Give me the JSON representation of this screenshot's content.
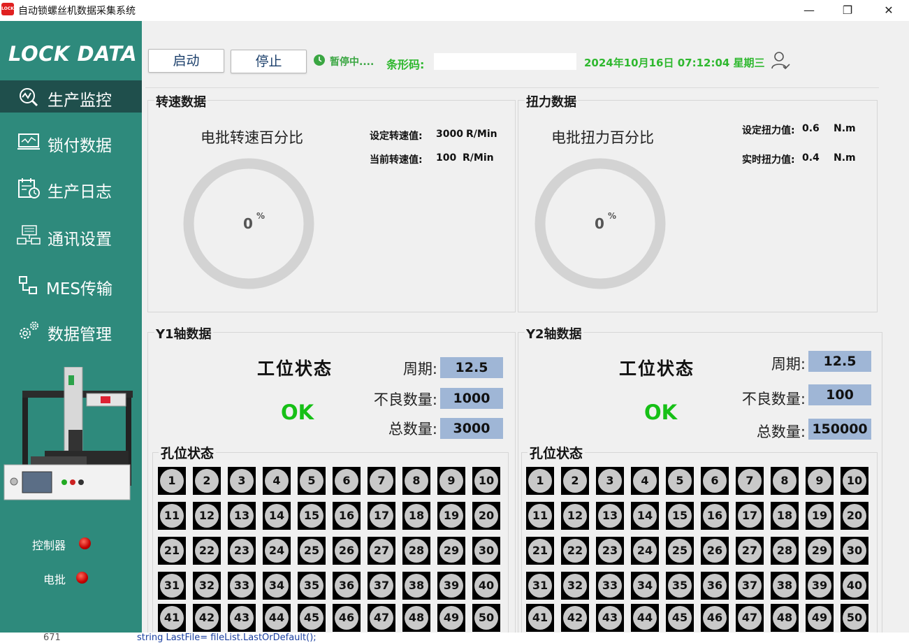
{
  "window": {
    "title": "自动锁螺丝机数据采集系统",
    "icon_text": "LOCK",
    "icon_color": "#e02020"
  },
  "sidebar": {
    "logo": "LOCK DATA",
    "bg_color": "#2e8a7c",
    "active_color": "#1f4f4c",
    "items": [
      {
        "label": "生产监控",
        "icon": "analytics-icon"
      },
      {
        "label": "锁付数据",
        "icon": "monitor-chart-icon"
      },
      {
        "label": "生产日志",
        "icon": "calendar-clock-icon"
      },
      {
        "label": "通讯设置",
        "icon": "network-icon"
      },
      {
        "label": "MES传输",
        "icon": "flow-icon"
      },
      {
        "label": "数据管理",
        "icon": "gears-icon"
      }
    ],
    "indicators": [
      {
        "label": "控制器",
        "status": "red"
      },
      {
        "label": "电批",
        "status": "red"
      }
    ]
  },
  "toolbar": {
    "start_label": "启动",
    "stop_label": "停止",
    "status_text": "暂停中....",
    "barcode_label": "条形码:",
    "barcode_value": "",
    "datetime": "2024年10月16日 07:12:04 星期三",
    "status_color": "#3aa642"
  },
  "speed_panel": {
    "title": "转速数据",
    "gauge_title": "电批转速百分比",
    "gauge_value": "0",
    "gauge_unit": "%",
    "gauge_percent": 0,
    "set_label": "设定转速值:",
    "set_value": "3000",
    "set_unit": "R/Min",
    "cur_label": "当前转速值:",
    "cur_value": "100",
    "cur_unit": "R/Min"
  },
  "torque_panel": {
    "title": "扭力数据",
    "gauge_title": "电批扭力百分比",
    "gauge_value": "0",
    "gauge_unit": "%",
    "gauge_percent": 0,
    "set_label": "设定扭力值:",
    "set_value": "0.6",
    "set_unit": "N.m",
    "cur_label": "实时扭力值:",
    "cur_value": "0.4",
    "cur_unit": "N.m"
  },
  "y1": {
    "title": "Y1轴数据",
    "state_title": "工位状态",
    "state": "OK",
    "cycle_label": "周期:",
    "cycle_value": "12.5",
    "bad_label": "不良数量:",
    "bad_value": "1000",
    "total_label": "总数量:",
    "total_value": "3000",
    "holes_title": "孔位状态"
  },
  "y2": {
    "title": "Y2轴数据",
    "state_title": "工位状态",
    "state": "OK",
    "cycle_label": "周期:",
    "cycle_value": "12.5",
    "bad_label": "不良数量:",
    "bad_value": "100",
    "total_label": "总数量:",
    "total_value": "150000",
    "holes_title": "孔位状态"
  },
  "holes": [
    "1",
    "2",
    "3",
    "4",
    "5",
    "6",
    "7",
    "8",
    "9",
    "10",
    "11",
    "12",
    "13",
    "14",
    "15",
    "16",
    "17",
    "18",
    "19",
    "20",
    "21",
    "22",
    "23",
    "24",
    "25",
    "26",
    "27",
    "28",
    "29",
    "30",
    "31",
    "32",
    "33",
    "34",
    "35",
    "36",
    "37",
    "38",
    "39",
    "40",
    "41",
    "42",
    "43",
    "44",
    "45",
    "46",
    "47",
    "48",
    "49",
    "50"
  ],
  "bottom_strip": {
    "line_no": "671",
    "code": "string LastFile= fileList.LastOrDefault();"
  }
}
